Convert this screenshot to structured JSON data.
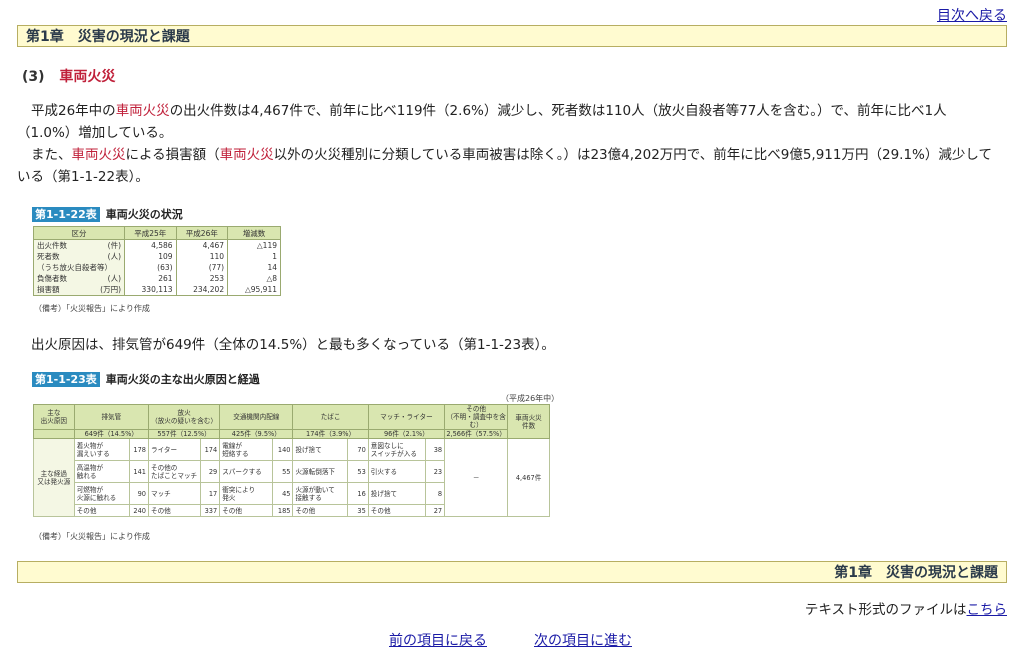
{
  "top_link": "目次へ戻る",
  "chapter_title": "第1章　災害の現況と課題",
  "section": {
    "number": "(3)",
    "title": "車両火災"
  },
  "para1": {
    "a": "平成26年中の",
    "b": "車両火災",
    "c": "の出火件数は4,467件で、前年に比べ119件（2.6%）減少し、死者数は110人（放火自殺者等77人を含む。）で、前年に比べ1人",
    "d": "（1.0%）増加している。"
  },
  "para2": {
    "a": "また、",
    "b": "車両火災",
    "c": "による損害額（",
    "d": "車両火災",
    "e": "以外の火災種別に分類している車両被害は除く。）は23億4,202万円で、前年に比べ9億5,911万円（29.1%）減少して",
    "f": "いる（第1-1-22表）。"
  },
  "table22": {
    "tag": "第1-1-22表",
    "title": "車両火災の状況",
    "headers": [
      "区分",
      "平成25年",
      "平成26年",
      "増減数"
    ],
    "rows": [
      {
        "label": "出火件数",
        "unit": "(件)",
        "v": [
          "4,586",
          "4,467",
          "△119"
        ]
      },
      {
        "label": "死者数",
        "unit": "(人)",
        "v": [
          "109",
          "110",
          "1"
        ]
      },
      {
        "label": "（うち放火自殺者等）",
        "unit": "",
        "v": [
          "(63)",
          "(77)",
          "14"
        ]
      },
      {
        "label": "負傷者数",
        "unit": "(人)",
        "v": [
          "261",
          "253",
          "△8"
        ]
      },
      {
        "label": "損害額",
        "unit": "(万円)",
        "v": [
          "330,113",
          "234,202",
          "△95,911"
        ]
      }
    ],
    "note": "（備考）「火災報告」により作成"
  },
  "para3": "出火原因は、排気管が649件（全体の14.5%）と最も多くなっている（第1-1-23表）。",
  "table23": {
    "tag": "第1-1-23表",
    "title": "車両火災の主な出火原因と経過",
    "year_note": "（平成26年中）",
    "corner": "主な\n出火原因",
    "side": "主な経過\n又は発火源",
    "causes": [
      {
        "name": "排気管",
        "count": "649件（14.5%）"
      },
      {
        "name": "放火\n（放火の疑いを含む）",
        "count": "557件（12.5%）"
      },
      {
        "name": "交通機関内配線",
        "count": "425件（9.5%）"
      },
      {
        "name": "たばこ",
        "count": "174件（3.9%）"
      },
      {
        "name": "マッチ・ライター",
        "count": "96件（2.1%）"
      }
    ],
    "other_cause": {
      "name": "その他\n（不明・調査中を含む）",
      "count": "2,566件（57.5%）",
      "dash": "－"
    },
    "total": {
      "name": "車両火災\n件数",
      "value": "4,467件"
    },
    "rows": [
      [
        [
          "着火物が\n漏えいする",
          "178"
        ],
        [
          "ライター",
          "174"
        ],
        [
          "電線が\n短絡する",
          "140"
        ],
        [
          "投げ捨て",
          "70"
        ],
        [
          "意図なしに\nスイッチが入る",
          "38"
        ]
      ],
      [
        [
          "高温物が\n触れる",
          "141"
        ],
        [
          "その他の\nたばことマッチ",
          "29"
        ],
        [
          "スパークする",
          "55"
        ],
        [
          "火源転倒落下",
          "53"
        ],
        [
          "引火する",
          "23"
        ]
      ],
      [
        [
          "可燃物が\n火源に触れる",
          "90"
        ],
        [
          "マッチ",
          "17"
        ],
        [
          "衝突により\n発火",
          "45"
        ],
        [
          "火源が動いて\n接触する",
          "16"
        ],
        [
          "投げ捨て",
          "8"
        ]
      ],
      [
        [
          "その他",
          "240"
        ],
        [
          "その他",
          "337"
        ],
        [
          "その他",
          "185"
        ],
        [
          "その他",
          "35"
        ],
        [
          "その他",
          "27"
        ]
      ]
    ],
    "note": "（備考）「火災報告」により作成"
  },
  "bottom_chapter": "第1章　災害の現況と課題",
  "text_file": {
    "prefix": "テキスト形式のファイルは",
    "link": "こちら"
  },
  "nav": {
    "prev": "前の項目に戻る",
    "next": "次の項目に進む"
  }
}
